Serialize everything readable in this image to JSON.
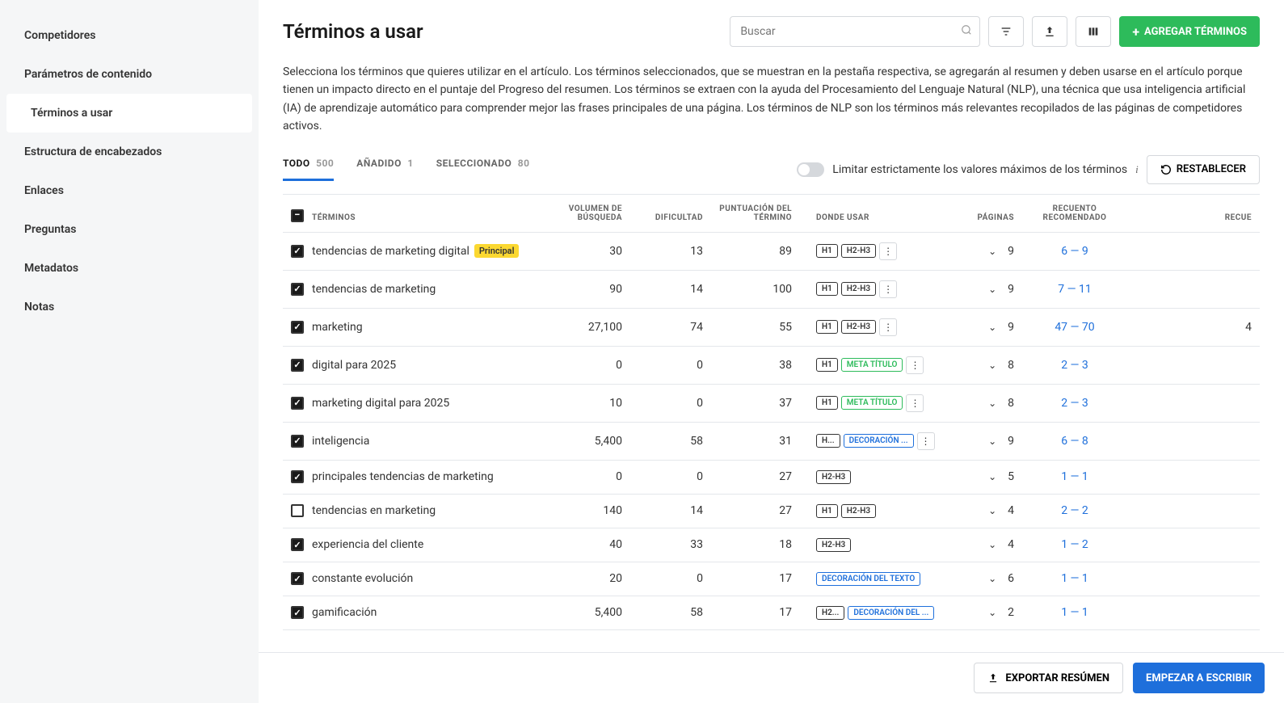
{
  "sidebar": {
    "items": [
      {
        "label": "Competidores",
        "active": false
      },
      {
        "label": "Parámetros de contenido",
        "active": false
      },
      {
        "label": "Términos a usar",
        "active": true
      },
      {
        "label": "Estructura de encabezados",
        "active": false
      },
      {
        "label": "Enlaces",
        "active": false
      },
      {
        "label": "Preguntas",
        "active": false
      },
      {
        "label": "Metadatos",
        "active": false
      },
      {
        "label": "Notas",
        "active": false
      }
    ]
  },
  "header": {
    "title": "Términos a usar",
    "search_placeholder": "Buscar",
    "add_button": "AGREGAR TÉRMINOS"
  },
  "description": "Selecciona los términos que quieres utilizar en el artículo. Los términos seleccionados, que se muestran en la pestaña respectiva, se agregarán al resumen y deben usarse en el artículo porque tienen un impacto directo en el puntaje del Progreso del resumen. Los términos se extraen con la ayuda del Procesamiento del Lenguaje Natural (NLP), una técnica que usa inteligencia artificial (IA) de aprendizaje automático para comprender mejor las frases principales de una página. Los términos de NLP son los términos más relevantes recopilados de las páginas de competidores activos.",
  "tabs": [
    {
      "label": "TODO",
      "count": "500",
      "active": true
    },
    {
      "label": "AÑADIDO",
      "count": "1",
      "active": false
    },
    {
      "label": "SELECCIONADO",
      "count": "80",
      "active": false
    }
  ],
  "controls": {
    "limit_label": "Limitar estrictamente los valores máximos de los términos",
    "reset_label": "RESTABLECER"
  },
  "columns": {
    "terms": "TÉRMINOS",
    "volume": "VOLUMEN DE BÚSQUEDA",
    "difficulty": "DIFICULTAD",
    "score": "PUNTUACIÓN DEL TÉRMINO",
    "where": "DONDE USAR",
    "pages": "PÁGINAS",
    "recommended": "RECUENTO RECOMENDADO",
    "extra": "RECUE"
  },
  "rows": [
    {
      "checked": true,
      "term": "tendencias de marketing digital",
      "main": true,
      "volume": "30",
      "difficulty": "13",
      "score": "89",
      "tags": [
        {
          "t": "H1"
        },
        {
          "t": "H2-H3"
        }
      ],
      "dots": true,
      "pages": "9",
      "rec": "6 — 9",
      "extra": ""
    },
    {
      "checked": true,
      "term": "tendencias de marketing",
      "volume": "90",
      "difficulty": "14",
      "score": "100",
      "tags": [
        {
          "t": "H1"
        },
        {
          "t": "H2-H3"
        }
      ],
      "dots": true,
      "pages": "9",
      "rec": "7 — 11",
      "extra": ""
    },
    {
      "checked": true,
      "term": "marketing",
      "volume": "27,100",
      "difficulty": "74",
      "score": "55",
      "tags": [
        {
          "t": "H1"
        },
        {
          "t": "H2-H3"
        }
      ],
      "dots": true,
      "pages": "9",
      "rec": "47 — 70",
      "extra": "4"
    },
    {
      "checked": true,
      "term": "digital para 2025",
      "volume": "0",
      "difficulty": "0",
      "score": "38",
      "tags": [
        {
          "t": "H1"
        },
        {
          "t": "META TÍTULO",
          "cls": "green"
        }
      ],
      "dots": true,
      "pages": "8",
      "rec": "2 — 3",
      "extra": ""
    },
    {
      "checked": true,
      "term": "marketing digital para 2025",
      "volume": "10",
      "difficulty": "0",
      "score": "37",
      "tags": [
        {
          "t": "H1"
        },
        {
          "t": "META TÍTULO",
          "cls": "green"
        }
      ],
      "dots": true,
      "pages": "8",
      "rec": "2 — 3",
      "extra": ""
    },
    {
      "checked": true,
      "term": "inteligencia",
      "volume": "5,400",
      "difficulty": "58",
      "score": "31",
      "tags": [
        {
          "t": "H..."
        },
        {
          "t": "DECORACIÓN ...",
          "cls": "blue"
        }
      ],
      "dots": true,
      "pages": "9",
      "rec": "6 — 8",
      "extra": ""
    },
    {
      "checked": true,
      "term": "principales tendencias de marketing",
      "volume": "0",
      "difficulty": "0",
      "score": "27",
      "tags": [
        {
          "t": "H2-H3"
        }
      ],
      "dots": false,
      "pages": "5",
      "rec": "1 — 1",
      "extra": ""
    },
    {
      "checked": false,
      "term": "tendencias en marketing",
      "volume": "140",
      "difficulty": "14",
      "score": "27",
      "tags": [
        {
          "t": "H1"
        },
        {
          "t": "H2-H3"
        }
      ],
      "dots": false,
      "pages": "4",
      "rec": "2 — 2",
      "extra": ""
    },
    {
      "checked": true,
      "term": "experiencia del cliente",
      "volume": "40",
      "difficulty": "33",
      "score": "18",
      "tags": [
        {
          "t": "H2-H3"
        }
      ],
      "dots": false,
      "pages": "4",
      "rec": "1 — 2",
      "extra": ""
    },
    {
      "checked": true,
      "term": "constante evolución",
      "volume": "20",
      "difficulty": "0",
      "score": "17",
      "tags": [
        {
          "t": "DECORACIÓN DEL TEXTO",
          "cls": "blue"
        }
      ],
      "dots": false,
      "pages": "6",
      "rec": "1 — 1",
      "extra": ""
    },
    {
      "checked": true,
      "term": "gamificación",
      "volume": "5,400",
      "difficulty": "58",
      "score": "17",
      "tags": [
        {
          "t": "H2..."
        },
        {
          "t": "DECORACIÓN DEL ...",
          "cls": "blue"
        }
      ],
      "dots": false,
      "pages": "2",
      "rec": "1 — 1",
      "extra": ""
    }
  ],
  "footer": {
    "export": "EXPORTAR RESÚMEN",
    "start": "EMPEZAR A ESCRIBIR"
  },
  "badge_main": "Principal"
}
